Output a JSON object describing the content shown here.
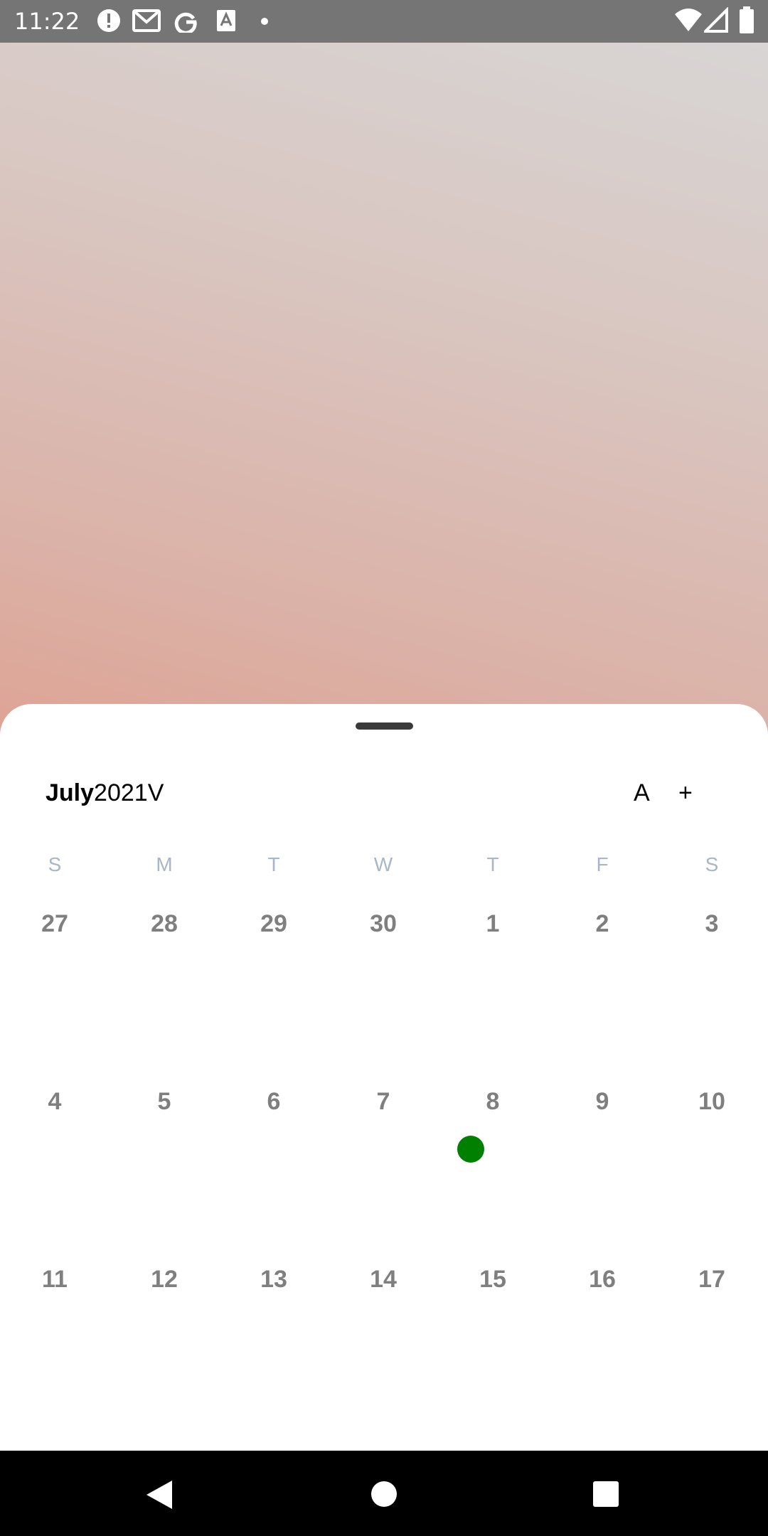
{
  "status_bar": {
    "time": "11:22",
    "left_icons": [
      "alert-icon",
      "gmail-icon",
      "google-icon",
      "font-icon",
      "dot-icon"
    ],
    "right_icons": [
      "wifi-icon",
      "signal-icon",
      "battery-icon"
    ]
  },
  "calendar": {
    "month": "July",
    "year": "2021",
    "toggle_label": "V",
    "text_button_label": "A",
    "add_button_label": "+",
    "weekdays": [
      "S",
      "M",
      "T",
      "W",
      "T",
      "F",
      "S"
    ],
    "weeks": [
      [
        "27",
        "28",
        "29",
        "30",
        "1",
        "2",
        "3"
      ],
      [
        "4",
        "5",
        "6",
        "7",
        "8",
        "9",
        "10"
      ],
      [
        "11",
        "12",
        "13",
        "14",
        "15",
        "16",
        "17"
      ]
    ],
    "event_marker_color": "#008000"
  },
  "nav_bar": {
    "icons": [
      "back-icon",
      "home-icon",
      "recents-icon"
    ]
  }
}
